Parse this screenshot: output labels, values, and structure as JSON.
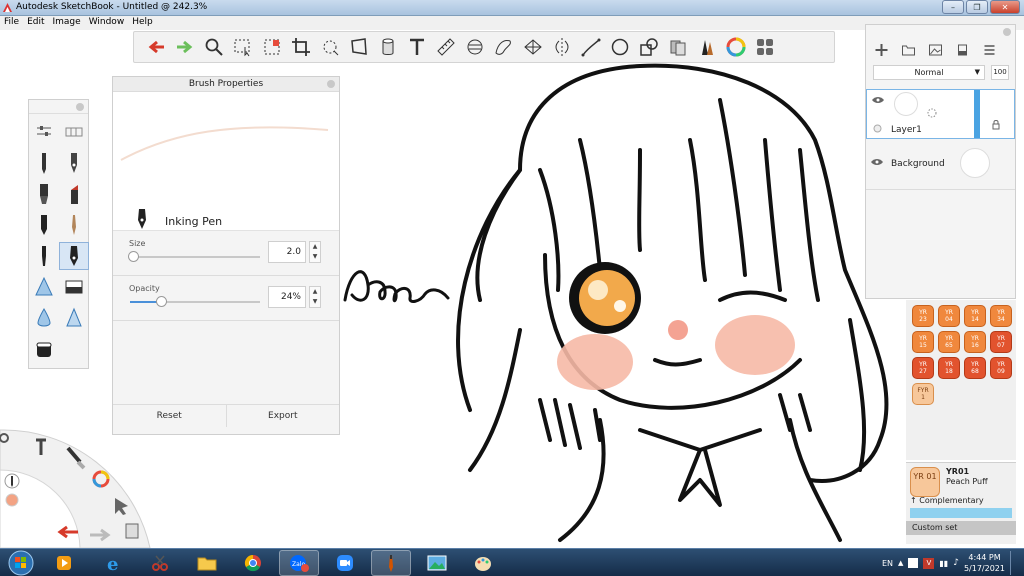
{
  "window": {
    "title": "Autodesk SketchBook - Untitled @ 242.3%"
  },
  "menu": [
    "File",
    "Edit",
    "Image",
    "Window",
    "Help"
  ],
  "toolbar": {
    "tools": [
      "undo-icon",
      "redo-icon",
      "zoom-icon",
      "select-icon",
      "crop-select-icon",
      "crop-icon",
      "lasso-transform-icon",
      "distort-icon",
      "fill-bucket-icon",
      "text-icon",
      "ruler-icon",
      "ellipse-guide-icon",
      "french-curve-icon",
      "perspective-icon",
      "symmetry-icon",
      "stroke-icon",
      "circle-icon",
      "shape-icon",
      "copic-library-icon",
      "brush-library-icon",
      "color-wheel-icon",
      "color-swatch-icon"
    ]
  },
  "brush_properties": {
    "title": "Brush Properties",
    "brush_name": "Inking Pen",
    "size_label": "Size",
    "size_value": "2.0",
    "size_fraction": 0.02,
    "opacity_label": "Opacity",
    "opacity_value": "24%",
    "opacity_fraction": 0.24,
    "reset_label": "Reset",
    "export_label": "Export"
  },
  "layers": {
    "blend_mode": "Normal",
    "opacity": "100",
    "items": [
      {
        "name": "Layer1",
        "selected": true
      },
      {
        "name": "Background",
        "selected": false
      }
    ]
  },
  "swatches": {
    "codes": [
      [
        "YR 23",
        "YR 04",
        "YR 14",
        "YR 34"
      ],
      [
        "YR 15",
        "YR 65",
        "YR 16",
        "YR 07"
      ],
      [
        "YR 27",
        "YR 18",
        "YR 68",
        "YR 09"
      ],
      [
        "FYR 1"
      ]
    ],
    "selected_code": "YR01",
    "selected_chip": "YR 01",
    "selected_name": "Peach Puff",
    "complementary_label": "↑ Complementary",
    "custom_set_label": "Custom set"
  },
  "canvas": {
    "signature_text": "Hwan"
  },
  "taskbar": {
    "language": "EN",
    "time": "4:44 PM",
    "date": "5/17/2021"
  }
}
